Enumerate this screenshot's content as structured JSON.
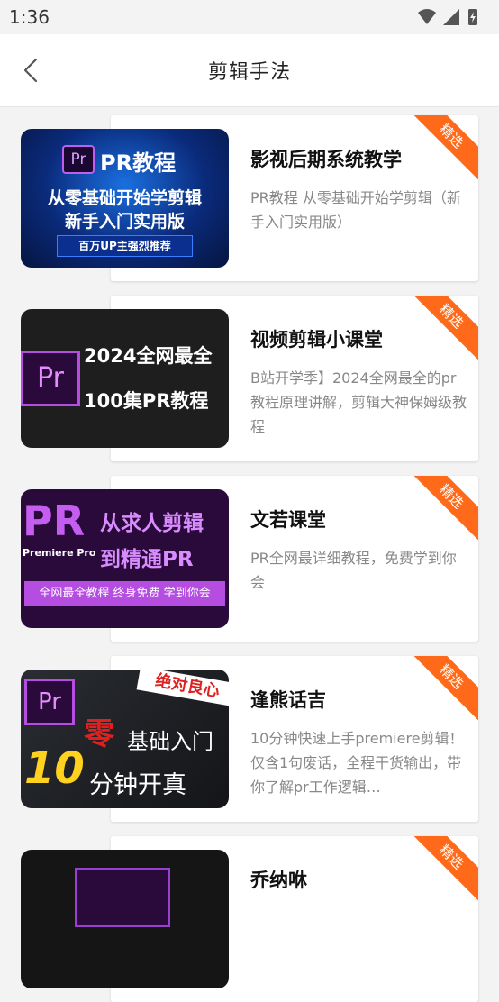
{
  "status": {
    "time": "1:36"
  },
  "header": {
    "title": "剪辑手法"
  },
  "badge_label": "精选",
  "items": [
    {
      "title": "影视后期系统教学",
      "desc": "PR教程 从零基础开始学剪辑（新手入门实用版）",
      "thumb": {
        "logo": "Pr",
        "title": "PR教程",
        "line1": "从零基础开始学剪辑",
        "line2": "新手入门实用版",
        "tag": "百万UP主强烈推荐"
      }
    },
    {
      "title": "视频剪辑小课堂",
      "desc": "B站开学季】2024全网最全的pr教程原理讲解，剪辑大神保姆级教程",
      "thumb": {
        "logo": "Pr",
        "line1": "2024全网最全",
        "line2": "100集PR教程"
      }
    },
    {
      "title": "文若课堂",
      "desc": "PR全网最详细教程，免费学到你会",
      "thumb": {
        "big": "PR",
        "sub": "Premiere Pro",
        "line1": "从求人剪辑",
        "line2": "到精通PR",
        "strip": "全网最全教程 终身免费 学到你会"
      }
    },
    {
      "title": "逢熊话吉",
      "desc": "10分钟快速上手premiere剪辑！仅含1句废话，全程干货输出，带你了解pr工作逻辑…",
      "thumb": {
        "logo": "Pr",
        "tag": "绝对良心",
        "zero": "零",
        "line1": "基础入门",
        "num": "10",
        "line2": "分钟开真"
      }
    },
    {
      "title": "乔纳咻",
      "desc": "",
      "thumb": {}
    }
  ]
}
